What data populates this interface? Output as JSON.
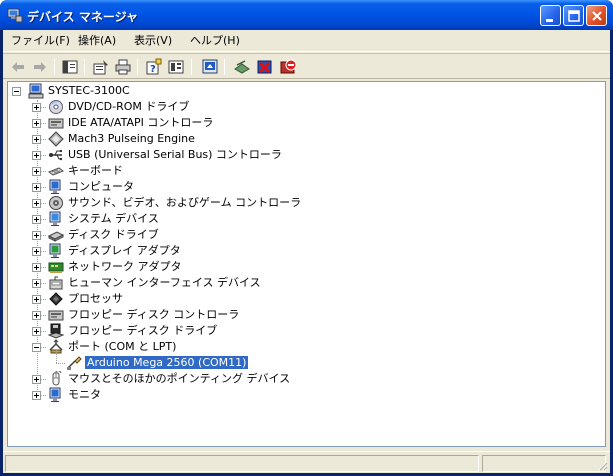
{
  "window": {
    "title": "デバイス マネージャ",
    "icon": "device-manager-icon",
    "caption_buttons": [
      "minimize-icon",
      "maximize-icon",
      "close-icon"
    ],
    "colors": {
      "titlebar": "#0055e5",
      "close": "#e0522a",
      "face": "#ece9d8",
      "selection": "#316ac5"
    }
  },
  "menubar": {
    "items": [
      {
        "label": "ファイル(F)"
      },
      {
        "label": "操作(A)"
      },
      {
        "label": "表示(V)"
      },
      {
        "label": "ヘルプ(H)"
      }
    ]
  },
  "toolbar": {
    "buttons": [
      "back-arrow-icon",
      "forward-arrow-icon",
      "show-hide-console-tree-icon",
      "properties-icon",
      "print-icon",
      "help-icon",
      "export-list-icon",
      "scan-hardware-icon",
      "update-driver-icon",
      "uninstall-icon",
      "disable-device-icon"
    ]
  },
  "tree": {
    "root": {
      "label": "SYSTEC-3100C",
      "icon": "computer-icon"
    },
    "categories": [
      {
        "label": "DVD/CD-ROM ドライブ",
        "icon": "cdrom-icon",
        "expanded": false
      },
      {
        "label": "IDE ATA/ATAPI コントローラ",
        "icon": "ide-controller-icon",
        "expanded": false
      },
      {
        "label": "Mach3 Pulseing Engine",
        "icon": "diamond-icon",
        "expanded": false
      },
      {
        "label": "USB (Universal Serial Bus) コントローラ",
        "icon": "usb-icon",
        "expanded": false
      },
      {
        "label": "キーボード",
        "icon": "keyboard-icon",
        "expanded": false
      },
      {
        "label": "コンピュータ",
        "icon": "monitor-icon",
        "expanded": false
      },
      {
        "label": "サウンド、ビデオ、およびゲーム コントローラ",
        "icon": "speaker-icon",
        "expanded": false
      },
      {
        "label": "システム デバイス",
        "icon": "system-device-icon",
        "expanded": false
      },
      {
        "label": "ディスク ドライブ",
        "icon": "disk-drive-icon",
        "expanded": false
      },
      {
        "label": "ディスプレイ アダプタ",
        "icon": "display-adapter-icon",
        "expanded": false
      },
      {
        "label": "ネットワーク アダプタ",
        "icon": "network-adapter-icon",
        "expanded": false
      },
      {
        "label": "ヒューマン インターフェイス デバイス",
        "icon": "hid-icon",
        "expanded": false
      },
      {
        "label": "プロセッサ",
        "icon": "processor-icon",
        "expanded": false
      },
      {
        "label": "フロッピー ディスク コントローラ",
        "icon": "floppy-controller-icon",
        "expanded": false
      },
      {
        "label": "フロッピー ディスク ドライブ",
        "icon": "floppy-drive-icon",
        "expanded": false
      },
      {
        "label": "ポート (COM と LPT)",
        "icon": "port-icon",
        "expanded": true,
        "children": [
          {
            "label": "Arduino Mega 2560 (COM11)",
            "icon": "port-connector-icon",
            "selected": true
          }
        ]
      },
      {
        "label": "マウスとそのほかのポインティング デバイス",
        "icon": "mouse-icon",
        "expanded": false
      },
      {
        "label": "モニタ",
        "icon": "monitor-icon",
        "expanded": false
      }
    ]
  }
}
